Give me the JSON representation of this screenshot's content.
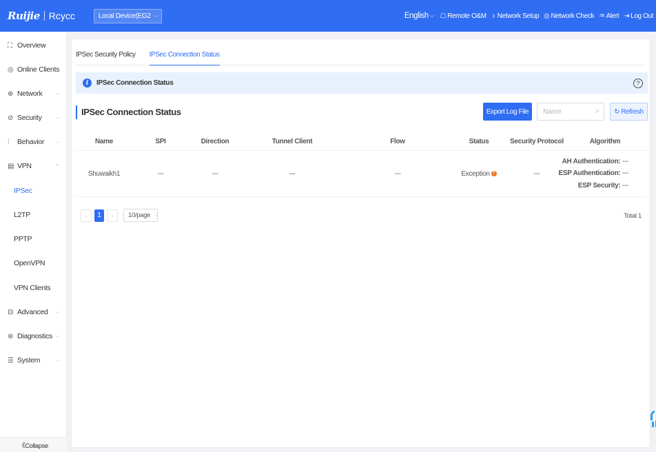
{
  "header": {
    "brand": "Ruijie",
    "product": "Rcycc",
    "device_select": "Local Device(EG2",
    "nav": [
      {
        "icon": "",
        "label": "English",
        "suffix": "⌵"
      },
      {
        "icon": "☖",
        "label": "Remote O&M"
      },
      {
        "icon": "♁",
        "label": "Network Setup"
      },
      {
        "icon": "◎",
        "label": "Network Check"
      },
      {
        "icon": "♒",
        "label": "Alert"
      },
      {
        "icon": "⇥",
        "label": "Log Out"
      }
    ]
  },
  "sidebar": {
    "items": [
      {
        "icon": "⛶",
        "label": "Overview",
        "arrow": ""
      },
      {
        "icon": "◎",
        "label": "Online Clients",
        "arrow": ""
      },
      {
        "icon": "⊕",
        "label": "Network",
        "arrow": "⌵"
      },
      {
        "icon": "⊘",
        "label": "Security",
        "arrow": "⌵"
      },
      {
        "icon": "⫶",
        "label": "Behavior",
        "arrow": "⌵"
      },
      {
        "icon": "▤",
        "label": "VPN",
        "arrow": "⌃"
      },
      {
        "icon": "",
        "label": "IPSec",
        "arrow": ""
      },
      {
        "icon": "",
        "label": "L2TP",
        "arrow": ""
      },
      {
        "icon": "",
        "label": "PPTP",
        "arrow": ""
      },
      {
        "icon": "",
        "label": "OpenVPN",
        "arrow": ""
      },
      {
        "icon": "",
        "label": "VPN Clients",
        "arrow": ""
      },
      {
        "icon": "⊟",
        "label": "Advanced",
        "arrow": "⌵"
      },
      {
        "icon": "⊛",
        "label": "Diagnostics",
        "arrow": "⌵"
      },
      {
        "icon": "☰",
        "label": "System",
        "arrow": "⌵"
      }
    ],
    "collapse_label": "《Collapse"
  },
  "tabs": [
    {
      "label": "IPSec Security Policy"
    },
    {
      "label": "IPSec Connection Status"
    }
  ],
  "info_bar": {
    "title": "IPSec Connection Status"
  },
  "section": {
    "title": "IPSec Connection Status",
    "export_label": "Export Log File",
    "search_placeholder": "Name",
    "refresh_label": "↻ Refresh"
  },
  "table": {
    "columns": [
      "Name",
      "SPI",
      "Direction",
      "Tunnel Client",
      "Flow",
      "Status",
      "Security Protocol",
      "Algorithm"
    ],
    "rows": [
      {
        "name": "Shuwaikh1",
        "spi": "---",
        "direction": "---",
        "tunnel_client": "---",
        "flow": "---",
        "status": "Exception",
        "security_protocol": "---",
        "algorithm": [
          {
            "key": "AH Authentication:",
            "value": "---"
          },
          {
            "key": "ESP Authentication:",
            "value": "---"
          },
          {
            "key": "ESP Security:",
            "value": "---"
          }
        ]
      }
    ]
  },
  "pagination": {
    "current": "1",
    "page_size": "10/page",
    "total": "Total 1"
  },
  "colors": {
    "primary": "#2f6df2",
    "warning": "#e8741a"
  }
}
